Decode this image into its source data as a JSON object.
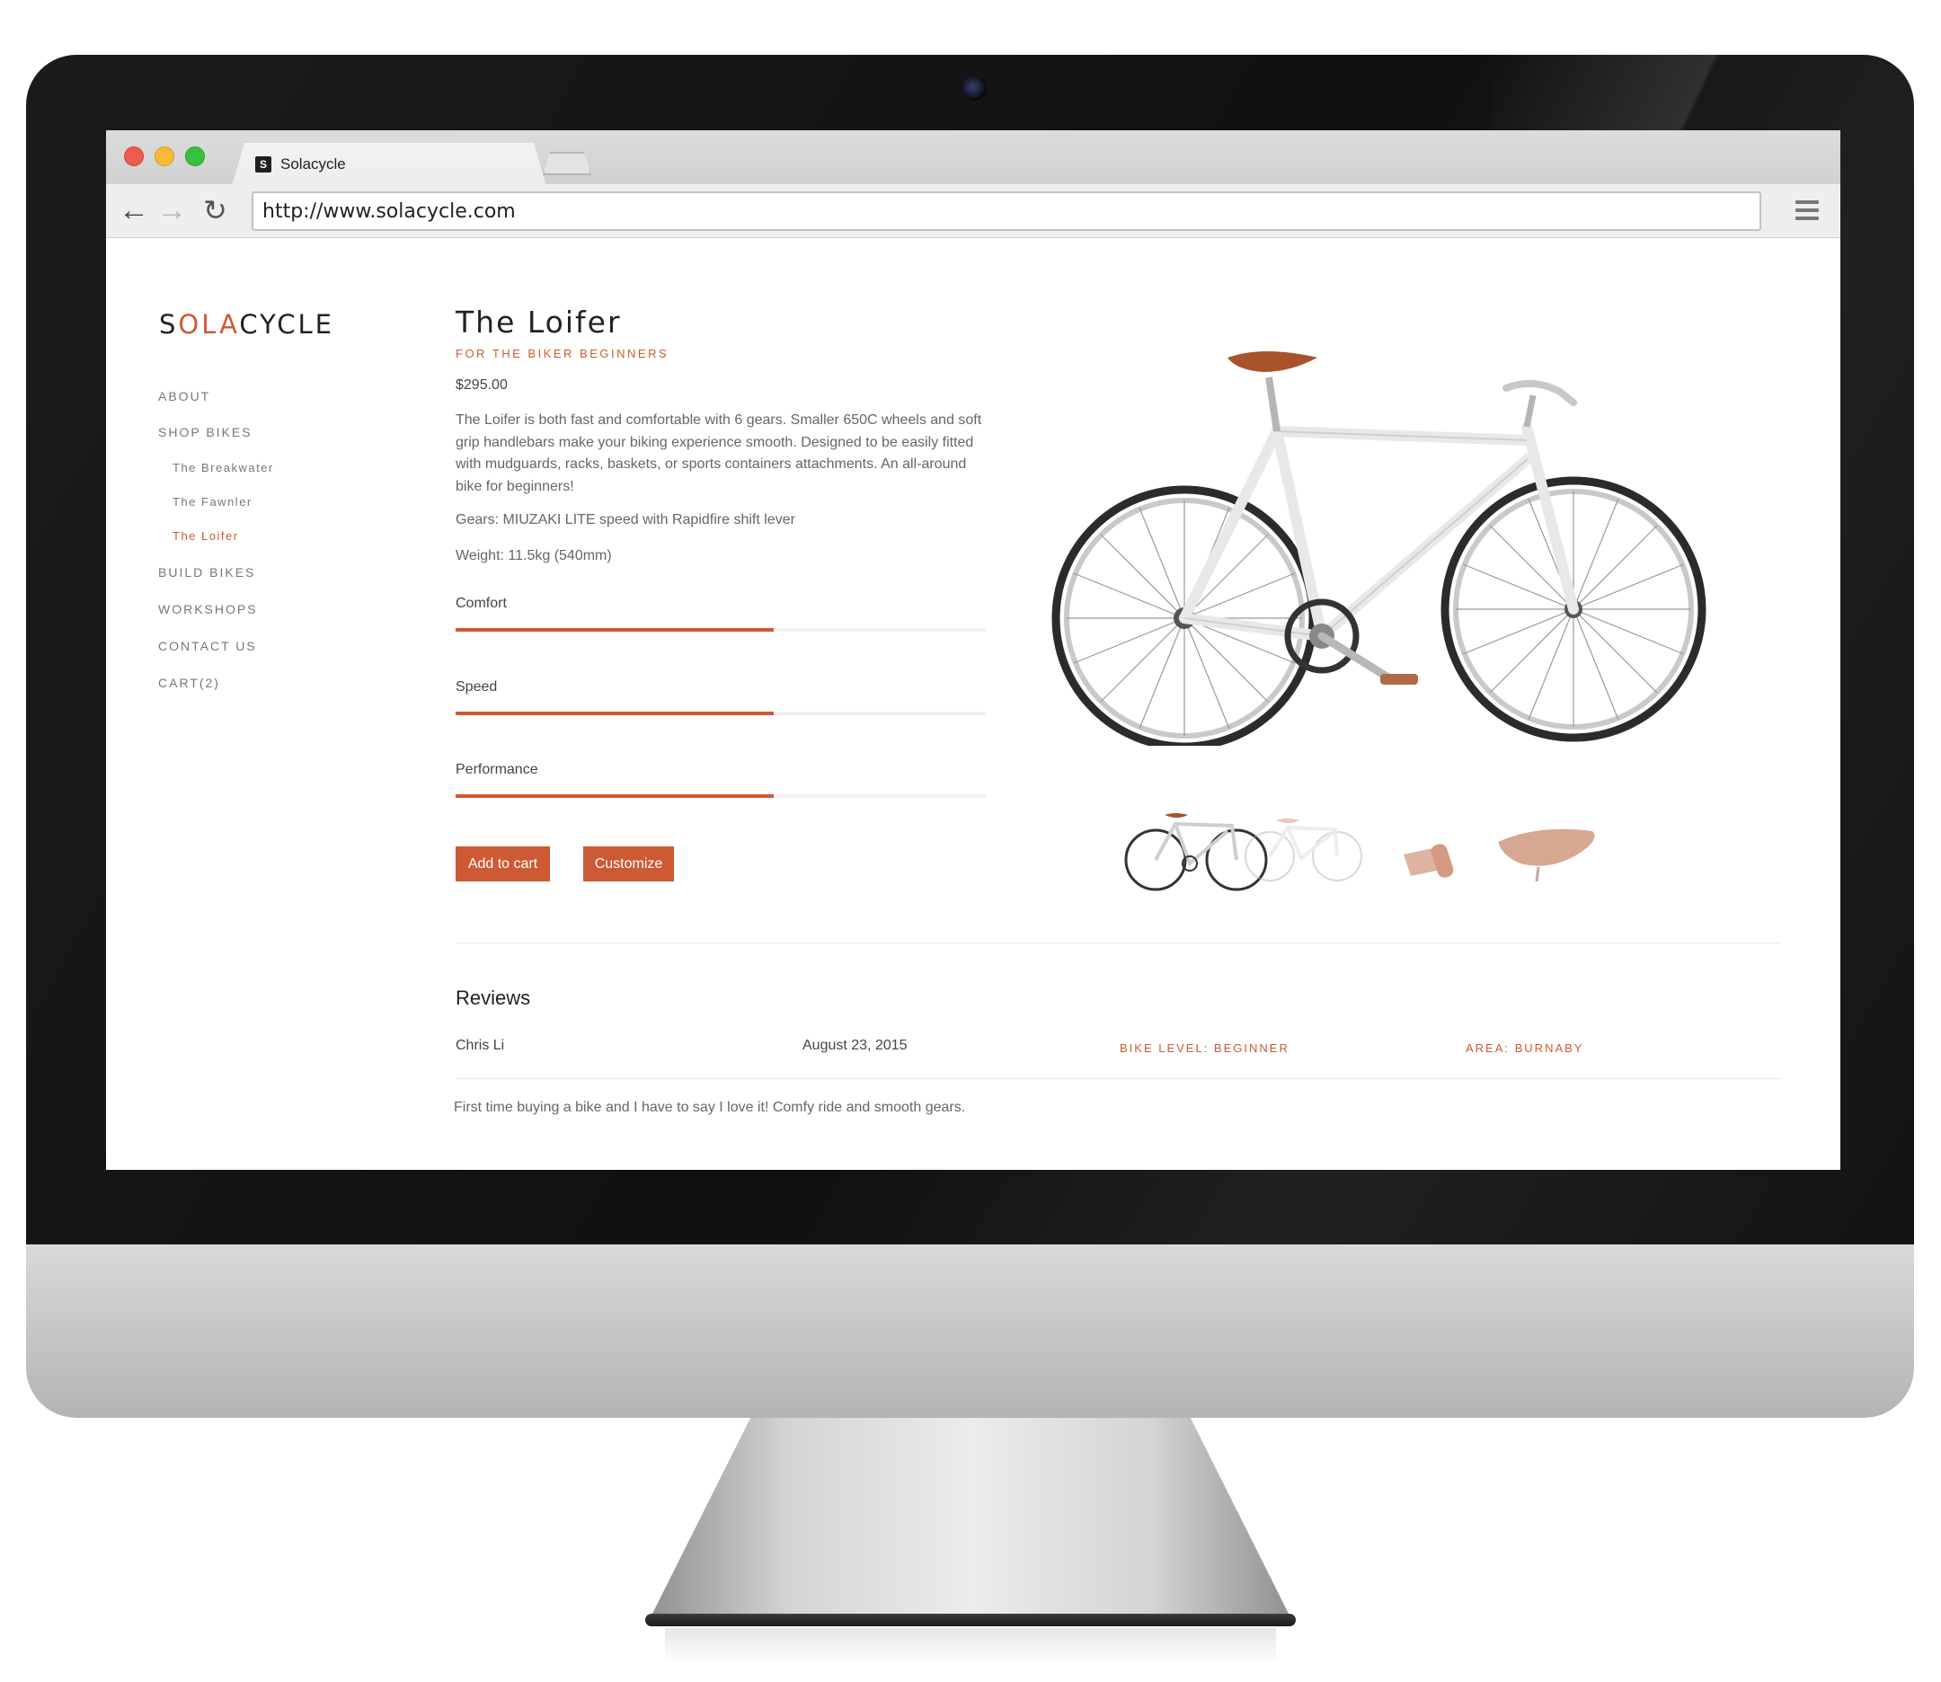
{
  "browser": {
    "tab_title": "Solacycle",
    "favicon_letter": "S",
    "url": "http://www.solacycle.com"
  },
  "site": {
    "logo": {
      "prefix": "S",
      "accent": "OLA",
      "suffix": "CYCLE"
    },
    "accent_color": "#cd5a34",
    "nav": {
      "about": "ABOUT",
      "shop_bikes": "SHOP BIKES",
      "sub_items": [
        "The Breakwater",
        "The Fawnler",
        "The Loifer"
      ],
      "active_sub_item": "The Loifer",
      "build_bikes": "BUILD BIKES",
      "workshops": "WORKSHOPS",
      "contact_us": "CONTACT US",
      "cart": "CART(2)"
    }
  },
  "product": {
    "title": "The Loifer",
    "subtitle": "FOR THE BIKER BEGINNERS",
    "price": "$295.00",
    "description": "The Loifer is both fast and comfortable with 6 gears. Smaller 650C wheels and soft grip handlebars make your biking experience smooth. Designed to be easily fitted with mudguards, racks, baskets, or sports containers attachments. An all-around bike for beginners!",
    "gears": "Gears: MIUZAKI LITE speed with Rapidfire shift lever",
    "weight": "Weight: 11.5kg (540mm)",
    "ratings": [
      {
        "label": "Comfort",
        "value": 0.6
      },
      {
        "label": "Speed",
        "value": 0.6
      },
      {
        "label": "Performance",
        "value": 0.6
      }
    ],
    "add_to_cart_label": "Add to cart",
    "customize_label": "Customize",
    "thumbnails": [
      "bike-front-thumbnail",
      "bike-frame-thumbnail",
      "handlebar-grip-thumbnail",
      "saddle-thumbnail"
    ]
  },
  "reviews": {
    "title": "Reviews",
    "items": [
      {
        "author": "Chris Li",
        "date": "August 23, 2015",
        "bike_level": "BIKE LEVEL: BEGINNER",
        "area": "AREA: BURNABY",
        "text": "First time buying a bike and I have to say I love it! Comfy ride and smooth gears."
      }
    ]
  }
}
